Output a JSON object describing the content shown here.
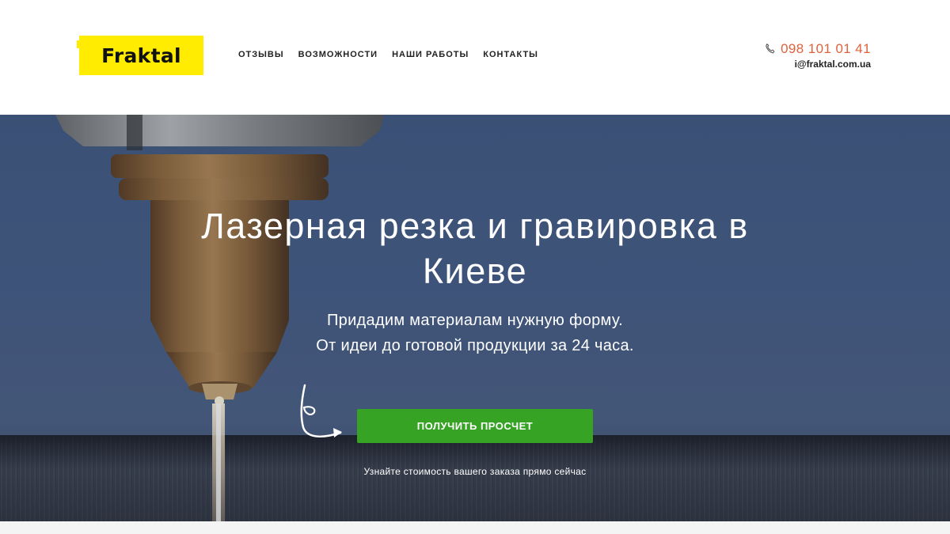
{
  "header": {
    "logo_text": "Fraktal",
    "logo_color": "#ffec00",
    "nav": [
      {
        "label": "ОТЗЫВЫ"
      },
      {
        "label": "ВОЗМОЖНОСТИ"
      },
      {
        "label": "НАШИ РАБОТЫ"
      },
      {
        "label": "КОНТАКТЫ"
      }
    ],
    "phone": "098 101 01 41",
    "phone_icon": "phone-icon",
    "email": "i@fraktal.com.ua"
  },
  "hero": {
    "title": "Лазерная резка и гравировка в Киеве",
    "subtitle_line1": "Придадим материалам нужную форму.",
    "subtitle_line2": "От идеи до готовой продукции за 24 часа.",
    "cta_label": "ПОЛУЧИТЬ ПРОСЧЕТ",
    "cta_note": "Узнайте стоимость вашего заказа прямо сейчас",
    "cta_color": "#37a325",
    "accent_color": "#e0623c"
  }
}
